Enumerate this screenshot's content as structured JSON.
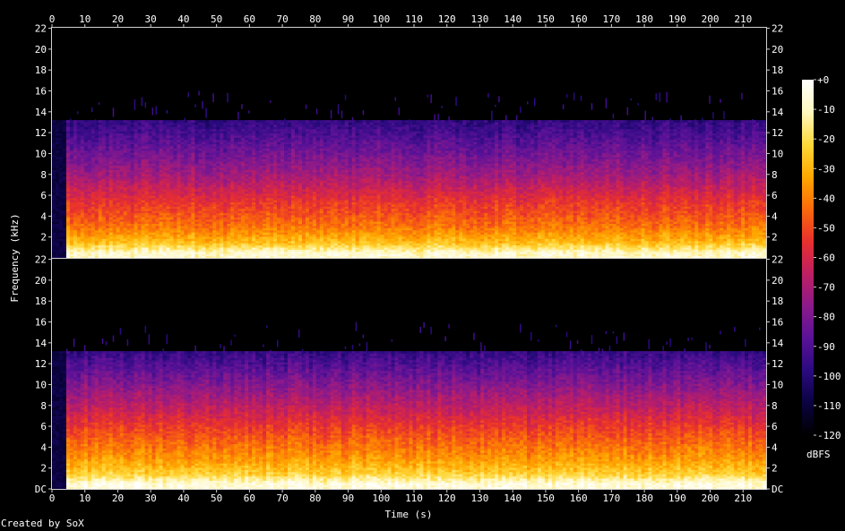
{
  "credit": "Created by SoX",
  "chart_data": {
    "type": "heatmap",
    "title": "",
    "xlabel": "Time (s)",
    "ylabel": "Frequency (kHz)",
    "xlim": [
      0,
      217
    ],
    "ylim": [
      0,
      22.05
    ],
    "x_ticks": [
      "0",
      "10",
      "20",
      "30",
      "40",
      "50",
      "60",
      "70",
      "80",
      "90",
      "100",
      "110",
      "120",
      "130",
      "140",
      "150",
      "160",
      "170",
      "180",
      "190",
      "200",
      "210"
    ],
    "y_ticks": [
      "DC",
      "2",
      "4",
      "6",
      "8",
      "10",
      "12",
      "14",
      "16",
      "18",
      "20",
      "22"
    ],
    "colorbar": {
      "label": "dBFS",
      "ticks": [
        "+0",
        "-10",
        "-20",
        "-30",
        "-40",
        "-50",
        "-60",
        "-70",
        "-80",
        "-90",
        "-100",
        "-110",
        "-120"
      ],
      "range": [
        -120,
        0
      ],
      "colors": [
        "#000000",
        "#0a0340",
        "#2b0a80",
        "#5a1298",
        "#8c1a8a",
        "#bf1f63",
        "#e8302e",
        "#fa6a0a",
        "#ffa800",
        "#ffd83a",
        "#fff7c0",
        "#ffffff"
      ]
    },
    "channels": [
      {
        "bandwidth_khz": 13.2,
        "sparse_high_band_khz": 16,
        "level_db_by_band": [
          [
            0.5,
            -8
          ],
          [
            1.5,
            -28
          ],
          [
            3,
            -42
          ],
          [
            5.5,
            -55
          ],
          [
            8,
            -72
          ],
          [
            10,
            -82
          ],
          [
            12,
            -92
          ],
          [
            13.2,
            -97
          ]
        ],
        "active_range_s": [
          3.5,
          216
        ]
      },
      {
        "bandwidth_khz": 13.2,
        "sparse_high_band_khz": 16,
        "level_db_by_band": [
          [
            0.5,
            -6
          ],
          [
            1.5,
            -24
          ],
          [
            3,
            -36
          ],
          [
            5.5,
            -50
          ],
          [
            8,
            -66
          ],
          [
            10,
            -78
          ],
          [
            12,
            -90
          ],
          [
            13.2,
            -96
          ]
        ],
        "active_range_s": [
          3.5,
          216
        ]
      }
    ]
  }
}
